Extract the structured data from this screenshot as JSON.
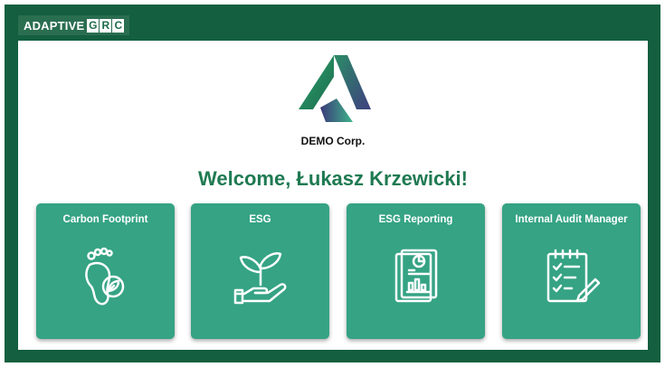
{
  "header": {
    "brand_word": "ADAPTIVE",
    "brand_letters": [
      "G",
      "R",
      "C"
    ]
  },
  "company": {
    "name": "DEMO Corp."
  },
  "welcome": "Welcome, Łukasz Krzewicki!",
  "tiles": [
    {
      "title": "Carbon Footprint",
      "icon": "footprint-icon"
    },
    {
      "title": "ESG",
      "icon": "plant-in-hand-icon"
    },
    {
      "title": "ESG Reporting",
      "icon": "report-document-icon"
    },
    {
      "title": "Internal Audit Manager",
      "icon": "audit-checklist-icon"
    }
  ],
  "colors": {
    "frame": "#135f3f",
    "tile": "#35a384",
    "welcome_text": "#1f7a52"
  }
}
